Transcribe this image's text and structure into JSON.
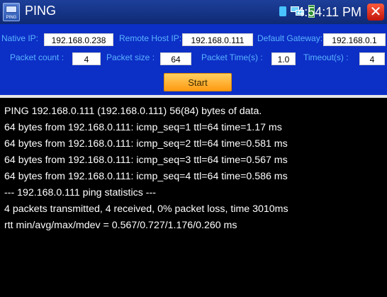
{
  "window": {
    "title": "PING",
    "app_icon_label": "PING",
    "time": "4:54:11 PM",
    "close_symbol": "✕"
  },
  "form": {
    "native_ip_label": "Native IP:",
    "native_ip_value": "192.168.0.238",
    "remote_host_ip_label": "Remote Host IP:",
    "remote_host_ip_value": "192.168.0.111",
    "default_gateway_label": "Default Gateway:",
    "default_gateway_value": "192.168.0.1",
    "packet_count_label": "Packet count :",
    "packet_count_value": "4",
    "packet_size_label": "Packet size :",
    "packet_size_value": "64",
    "packet_time_label": "Packet Time(s) :",
    "packet_time_value": "1.0",
    "timeout_label": "Timeout(s) :",
    "timeout_value": "4",
    "start_label": "Start"
  },
  "output": [
    "PING 192.168.0.111 (192.168.0.111) 56(84) bytes of data.",
    "64 bytes from 192.168.0.111: icmp_seq=1 ttl=64 time=1.17 ms",
    "64 bytes from 192.168.0.111: icmp_seq=2 ttl=64 time=0.581 ms",
    "64 bytes from 192.168.0.111: icmp_seq=3 ttl=64 time=0.567 ms",
    "64 bytes from 192.168.0.111: icmp_seq=4 ttl=64 time=0.586 ms",
    "--- 192.168.0.111 ping statistics ---",
    "4 packets transmitted, 4 received, 0% packet loss, time 3010ms",
    "rtt min/avg/max/mdev = 0.567/0.727/1.176/0.260 ms"
  ],
  "colors": {
    "title_bar": "#1d3f9a",
    "panel": "#0c2fc6",
    "label_text": "#5ab4ff",
    "start_button": "#ffb531",
    "close_button": "#e0301c",
    "terminal_bg": "#000000",
    "terminal_text": "#ffffff"
  },
  "icons": {
    "app": "ping-app-icon",
    "sim": "sim-card-icon",
    "network": "network-icon",
    "battery": "battery-icon",
    "close": "close-icon"
  }
}
